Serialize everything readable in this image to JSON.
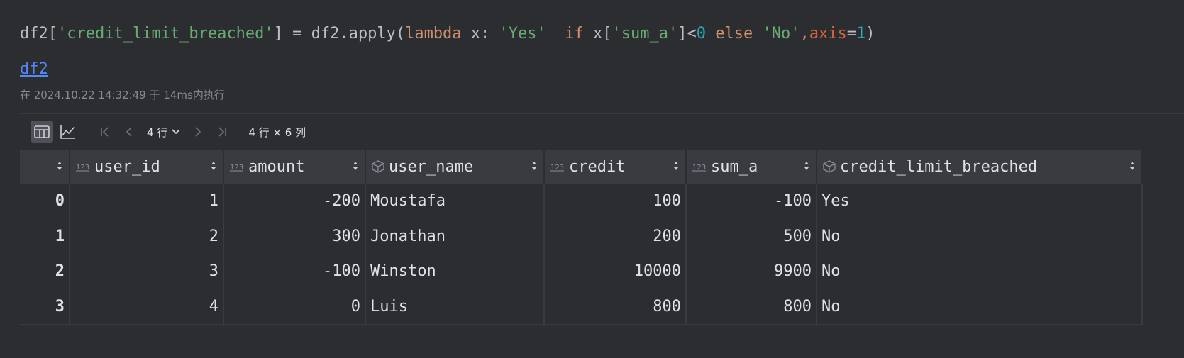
{
  "code": {
    "var": "df2",
    "open_bracket": "[",
    "key": "'credit_limit_breached'",
    "assign": "] = df2.apply(",
    "lambda_kw": "lambda",
    "lambda_arg": " x: ",
    "yes_str": "'Yes'",
    "space": "  ",
    "if_kw": "if",
    "x_index": " x[",
    "sum_key": "'sum_a'",
    "compare": "]<",
    "zero": "0",
    "else_kw": "else",
    "no_str": "'No'",
    "comma": ",",
    "axis_name": "axis",
    "equals": "=",
    "one": "1",
    "close": ")"
  },
  "output": {
    "var_link": "df2",
    "exec_info": "在 2024.10.22 14:32:49 于 14ms内执行"
  },
  "toolbar": {
    "table_view_icon": "table-grid-icon",
    "chart_view_icon": "line-chart-icon",
    "first_page_icon": "first-page-icon",
    "prev_page_icon": "chevron-left-icon",
    "rows_label": "4 行",
    "next_page_icon": "chevron-right-icon",
    "last_page_icon": "last-page-icon",
    "shape_label": "4 行 × 6 列"
  },
  "table": {
    "columns": [
      {
        "name": "user_id",
        "type_icon": "numeric-type-icon"
      },
      {
        "name": "amount",
        "type_icon": "numeric-type-icon"
      },
      {
        "name": "user_name",
        "type_icon": "object-type-icon"
      },
      {
        "name": "credit",
        "type_icon": "numeric-type-icon"
      },
      {
        "name": "sum_a",
        "type_icon": "numeric-type-icon"
      },
      {
        "name": "credit_limit_breached",
        "type_icon": "object-type-icon"
      }
    ],
    "rows": [
      {
        "index": "0",
        "user_id": "1",
        "amount": "-200",
        "user_name": "Moustafa",
        "credit": "100",
        "sum_a": "-100",
        "credit_limit_breached": "Yes"
      },
      {
        "index": "1",
        "user_id": "2",
        "amount": "300",
        "user_name": "Jonathan",
        "credit": "200",
        "sum_a": "500",
        "credit_limit_breached": "No"
      },
      {
        "index": "2",
        "user_id": "3",
        "amount": "-100",
        "user_name": "Winston",
        "credit": "10000",
        "sum_a": "9900",
        "credit_limit_breached": "No"
      },
      {
        "index": "3",
        "user_id": "4",
        "amount": "0",
        "user_name": "Luis",
        "credit": "800",
        "sum_a": "800",
        "credit_limit_breached": "No"
      }
    ]
  },
  "colors": {
    "background": "#2b2d30",
    "header_bg": "#393b40",
    "text": "#dfe1e5",
    "string": "#6aab73",
    "keyword": "#cf8e6d",
    "number": "#2aacb8",
    "param": "#d5643d",
    "link": "#548af7",
    "muted": "#868a91"
  }
}
